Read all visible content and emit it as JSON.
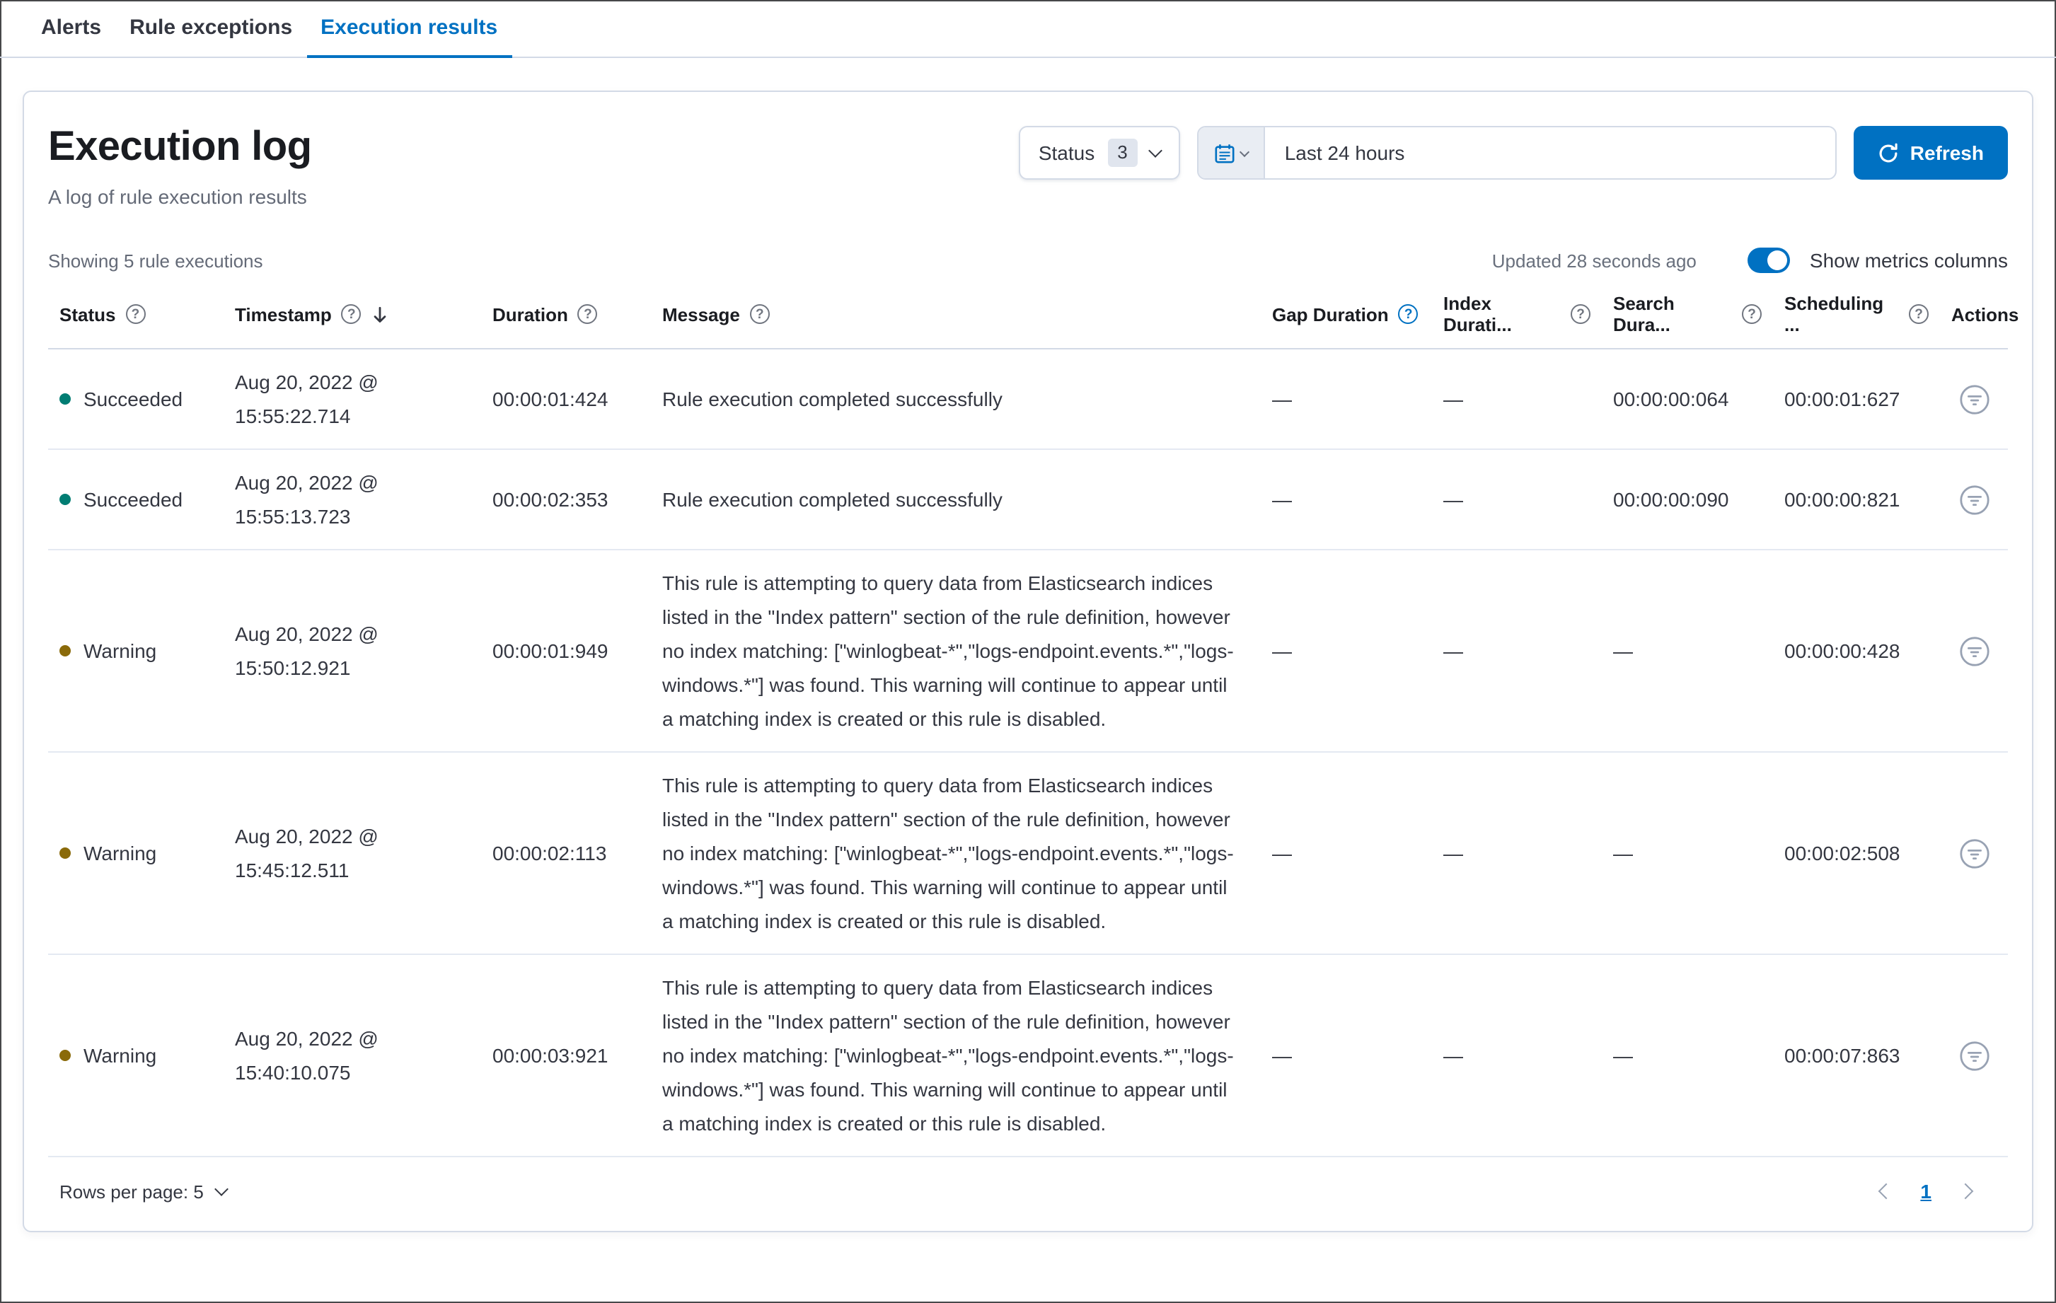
{
  "tabs": [
    {
      "label": "Alerts",
      "active": false
    },
    {
      "label": "Rule exceptions",
      "active": false
    },
    {
      "label": "Execution results",
      "active": true
    }
  ],
  "header": {
    "title": "Execution log",
    "subtitle": "A log of rule execution results"
  },
  "filters": {
    "status_label": "Status",
    "status_count": "3",
    "date_range": "Last 24 hours",
    "refresh_label": "Refresh"
  },
  "table_meta": {
    "showing": "Showing 5 rule executions",
    "updated": "Updated 28 seconds ago",
    "metrics_toggle_label": "Show metrics columns",
    "metrics_toggle_on": true
  },
  "columns": [
    {
      "label": "Status",
      "help": true
    },
    {
      "label": "Timestamp",
      "help": true,
      "sorted": true
    },
    {
      "label": "Duration",
      "help": true
    },
    {
      "label": "Message",
      "help": true
    },
    {
      "label": "Gap Duration",
      "help": true,
      "help_highlight": true
    },
    {
      "label": "Index Durati...",
      "help": true
    },
    {
      "label": "Search Dura...",
      "help": true
    },
    {
      "label": "Scheduling ...",
      "help": true
    },
    {
      "label": "Actions",
      "help": false
    }
  ],
  "rows": [
    {
      "status": "Succeeded",
      "status_color": "#017d73",
      "timestamp_date": "Aug 20, 2022 @",
      "timestamp_time": "15:55:22.714",
      "duration": "00:00:01:424",
      "message": "Rule execution completed successfully",
      "gap_duration": "—",
      "index_duration": "—",
      "search_duration": "00:00:00:064",
      "scheduling_delay": "00:00:01:627"
    },
    {
      "status": "Succeeded",
      "status_color": "#017d73",
      "timestamp_date": "Aug 20, 2022 @",
      "timestamp_time": "15:55:13.723",
      "duration": "00:00:02:353",
      "message": "Rule execution completed successfully",
      "gap_duration": "—",
      "index_duration": "—",
      "search_duration": "00:00:00:090",
      "scheduling_delay": "00:00:00:821"
    },
    {
      "status": "Warning",
      "status_color": "#8a6a0a",
      "timestamp_date": "Aug 20, 2022 @",
      "timestamp_time": "15:50:12.921",
      "duration": "00:00:01:949",
      "message": "This rule is attempting to query data from Elasticsearch indices listed in the \"Index pattern\" section of the rule definition, however no index matching: [\"winlogbeat-*\",\"logs-endpoint.events.*\",\"logs-windows.*\"] was found. This warning will continue to appear until a matching index is created or this rule is disabled.",
      "gap_duration": "—",
      "index_duration": "—",
      "search_duration": "—",
      "scheduling_delay": "00:00:00:428"
    },
    {
      "status": "Warning",
      "status_color": "#8a6a0a",
      "timestamp_date": "Aug 20, 2022 @",
      "timestamp_time": "15:45:12.511",
      "duration": "00:00:02:113",
      "message": "This rule is attempting to query data from Elasticsearch indices listed in the \"Index pattern\" section of the rule definition, however no index matching: [\"winlogbeat-*\",\"logs-endpoint.events.*\",\"logs-windows.*\"] was found. This warning will continue to appear until a matching index is created or this rule is disabled.",
      "gap_duration": "—",
      "index_duration": "—",
      "search_duration": "—",
      "scheduling_delay": "00:00:02:508"
    },
    {
      "status": "Warning",
      "status_color": "#8a6a0a",
      "timestamp_date": "Aug 20, 2022 @",
      "timestamp_time": "15:40:10.075",
      "duration": "00:00:03:921",
      "message": "This rule is attempting to query data from Elasticsearch indices listed in the \"Index pattern\" section of the rule definition, however no index matching: [\"winlogbeat-*\",\"logs-endpoint.events.*\",\"logs-windows.*\"] was found. This warning will continue to appear until a matching index is created or this rule is disabled.",
      "gap_duration": "—",
      "index_duration": "—",
      "search_duration": "—",
      "scheduling_delay": "00:00:07:863"
    }
  ],
  "pagination": {
    "rows_per_page": "Rows per page: 5",
    "current_page": "1"
  },
  "colors": {
    "accent": "#0071c2",
    "success_dot": "#017d73",
    "warning_dot": "#8a6a0a",
    "border": "#d3dae6"
  }
}
